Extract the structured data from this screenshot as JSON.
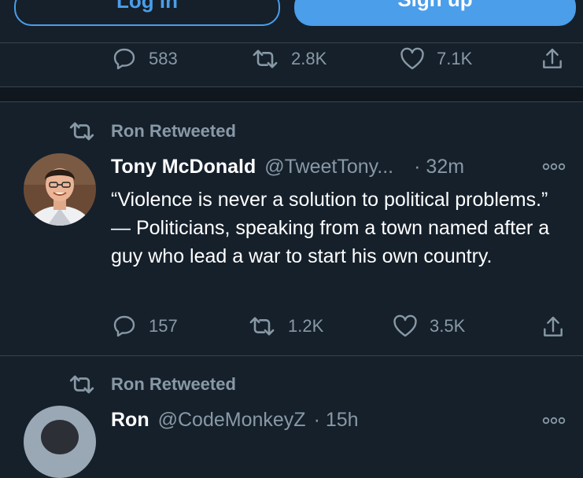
{
  "auth": {
    "login_label": "Log in",
    "signup_label": "Sign up"
  },
  "top_actions": {
    "replies": "583",
    "retweets": "2.8K",
    "likes": "7.1K"
  },
  "tweet": {
    "retweeted_by": "Ron Retweeted",
    "author_name": "Tony McDonald",
    "author_handle": "@TweetTony...",
    "time": "· 32m",
    "text": "“Violence is never a solution to political problems.” — Politicians, speaking from a town named after a guy who lead a war to start his own country.",
    "replies": "157",
    "retweets": "1.2K",
    "likes": "3.5K"
  },
  "next_tweet": {
    "retweeted_by": "Ron Retweeted",
    "author_name": "Ron",
    "author_handle": "@CodeMonkeyZ",
    "time": "· 15h"
  },
  "colors": {
    "background": "#15202b",
    "accent": "#4a9eea",
    "muted": "#8899a6",
    "divider": "#38444d"
  }
}
